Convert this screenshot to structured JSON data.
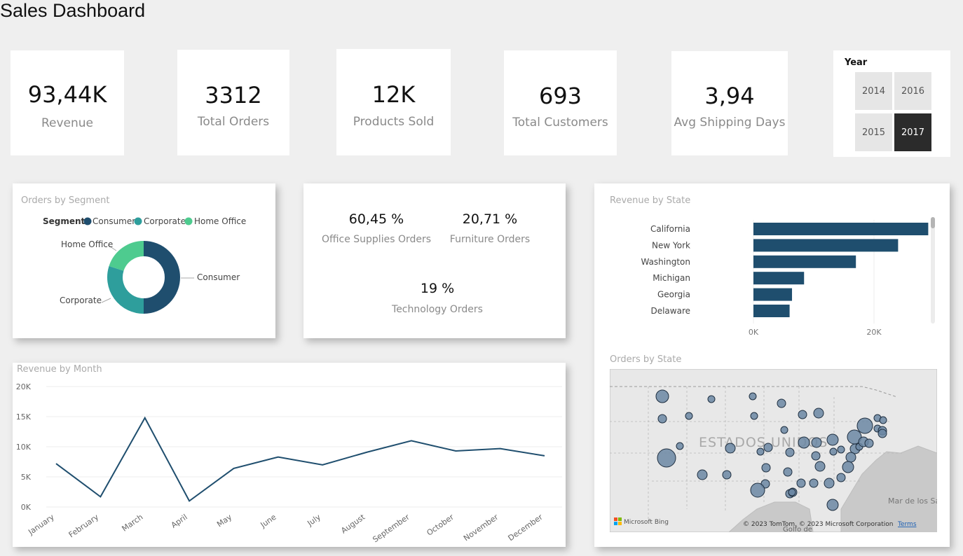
{
  "page": {
    "title": "Sales Dashboard"
  },
  "kpis": [
    {
      "value": "93,44K",
      "label": "Revenue"
    },
    {
      "value": "3312",
      "label": "Total Orders"
    },
    {
      "value": "12K",
      "label": "Products Sold"
    },
    {
      "value": "693",
      "label": "Total Customers"
    },
    {
      "value": "3,94",
      "label": "Avg Shipping Days"
    }
  ],
  "year_slicer": {
    "title": "Year",
    "options": [
      "2014",
      "2016",
      "2015",
      "2017"
    ],
    "selected": "2017"
  },
  "segment": {
    "title": "Orders by Segment",
    "legend_title": "Segment",
    "colors": {
      "Consumer": "#1f4e6e",
      "Corporate": "#2e9e9c",
      "Home Office": "#4ecb8f"
    }
  },
  "category_pct": {
    "office": {
      "value": "60,45 %",
      "label": "Office Supplies Orders"
    },
    "furniture": {
      "value": "20,71 %",
      "label": "Furniture Orders"
    },
    "technology": {
      "value": "19 %",
      "label": "Technology Orders"
    }
  },
  "state_revenue": {
    "title": "Revenue by State",
    "color": "#1f4e6e"
  },
  "month_revenue": {
    "title": "Revenue by Month",
    "color": "#1f4e6e"
  },
  "map": {
    "title": "Orders by State",
    "country_label": "ESTADOS UNIDOS",
    "sea_label": "Mar de los Sa",
    "gulf_label": "Golfo de",
    "provider": "Microsoft Bing",
    "copyright": "© 2023 TomTom, © 2023 Microsoft Corporation",
    "terms": "Terms"
  },
  "chart_data": [
    {
      "type": "pie",
      "title": "Orders by Segment",
      "legend": "top-left",
      "categories": [
        "Consumer",
        "Corporate",
        "Home Office"
      ],
      "values": [
        50,
        30,
        20
      ]
    },
    {
      "type": "bar",
      "title": "Revenue by State",
      "orientation": "horizontal",
      "categories": [
        "California",
        "New York",
        "Washington",
        "Michigan",
        "Georgia",
        "Delaware"
      ],
      "values": [
        29000,
        24000,
        17000,
        8400,
        6400,
        6000
      ],
      "x_ticks": [
        "0K",
        "20K"
      ],
      "xlim": [
        0,
        30000
      ],
      "grid": true
    },
    {
      "type": "line",
      "title": "Revenue by Month",
      "categories": [
        "January",
        "February",
        "March",
        "April",
        "May",
        "June",
        "July",
        "August",
        "September",
        "October",
        "November",
        "December"
      ],
      "values": [
        7200,
        1700,
        14800,
        1000,
        6400,
        8300,
        7000,
        9100,
        11000,
        9300,
        9700,
        8500
      ],
      "y_ticks": [
        "0K",
        "5K",
        "10K",
        "15K",
        "20K"
      ],
      "ylim": [
        0,
        20000
      ],
      "grid": true
    }
  ]
}
